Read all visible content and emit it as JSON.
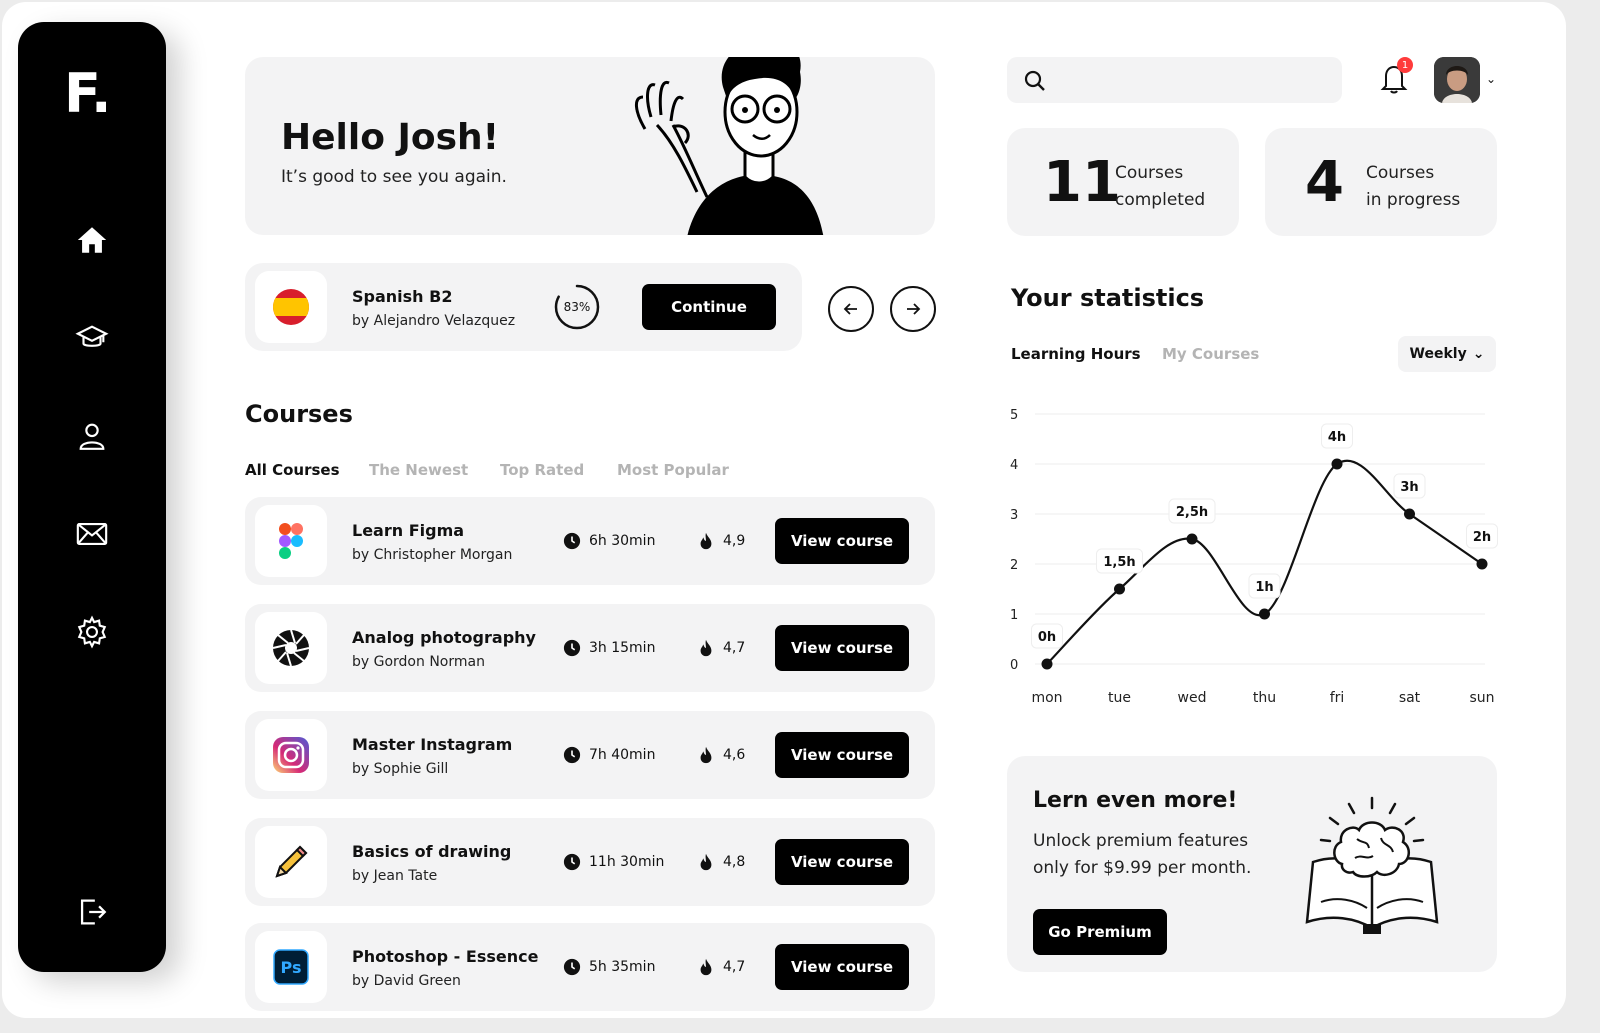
{
  "brand": {
    "logo": "F."
  },
  "hero": {
    "title": "Hello Josh!",
    "subtitle": "It’s good to see you again."
  },
  "current_course": {
    "title": "Spanish B2",
    "author": "by Alejandro Velazquez",
    "progress_label": "83%",
    "progress": 0.83,
    "button": "Continue"
  },
  "courses": {
    "title": "Courses",
    "tabs": [
      "All Courses",
      "The Newest",
      "Top Rated",
      "Most Popular"
    ],
    "view_label": "View course",
    "items": [
      {
        "title": "Learn Figma",
        "author": "by Christopher Morgan",
        "duration": "6h 30min",
        "rating": "4,9",
        "icon": "figma-icon"
      },
      {
        "title": "Analog photography",
        "author": "by Gordon Norman",
        "duration": "3h 15min",
        "rating": "4,7",
        "icon": "aperture-icon"
      },
      {
        "title": "Master Instagram",
        "author": "by Sophie Gill",
        "duration": "7h 40min",
        "rating": "4,6",
        "icon": "instagram-icon"
      },
      {
        "title": "Basics of drawing",
        "author": "by Jean Tate",
        "duration": "11h 30min",
        "rating": "4,8",
        "icon": "pencil-icon"
      },
      {
        "title": "Photoshop - Essence",
        "author": "by David Green",
        "duration": "5h 35min",
        "rating": "4,7",
        "icon": "photoshop-icon"
      }
    ]
  },
  "header": {
    "search_placeholder": "",
    "notifications": "1"
  },
  "stats": {
    "completed": {
      "value": "11",
      "line1": "Courses",
      "line2": "completed"
    },
    "in_progress": {
      "value": "4",
      "line1": "Courses",
      "line2": "in progress"
    }
  },
  "statistics": {
    "title": "Your statistics",
    "tabs": [
      "Learning Hours",
      "My Courses"
    ],
    "period": "Weekly"
  },
  "chart_data": {
    "type": "line",
    "categories": [
      "mon",
      "tue",
      "wed",
      "thu",
      "fri",
      "sat",
      "sun"
    ],
    "values": [
      0,
      1.5,
      2.5,
      1,
      4,
      3,
      2
    ],
    "labels": [
      "0h",
      "1,5h",
      "2,5h",
      "1h",
      "4h",
      "3h",
      "2h"
    ],
    "ylim": [
      0,
      5
    ],
    "yticks": [
      "0",
      "1",
      "2",
      "3",
      "4",
      "5"
    ],
    "grid": true
  },
  "premium": {
    "title": "Lern even more!",
    "line1": "Unlock premium features",
    "line2": "only for $9.99 per month.",
    "button": "Go Premium"
  },
  "colors": {
    "accent": "#000000",
    "card": "#f3f3f4",
    "badge": "#ff3b3b"
  }
}
